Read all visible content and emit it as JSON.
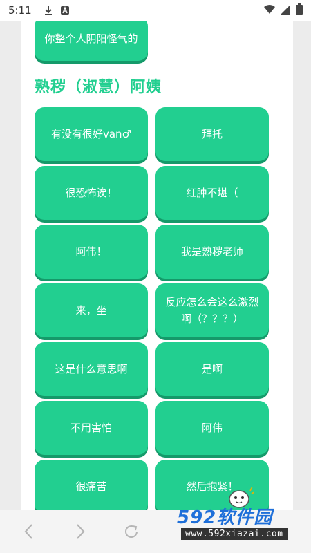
{
  "status_bar": {
    "time": "5:11",
    "icons_left": [
      "download-icon",
      "notification-a-icon"
    ],
    "icons_right": [
      "wifi-icon",
      "signal-icon",
      "battery-icon"
    ]
  },
  "top_partial_button": {
    "label": "你整个人阴阳怪气的"
  },
  "section": {
    "title": "熟秽（淑慧）阿姨"
  },
  "sound_buttons": [
    {
      "label": "有没有很好van♂"
    },
    {
      "label": "拜托"
    },
    {
      "label": "很恐怖诶！"
    },
    {
      "label": "红肿不堪（"
    },
    {
      "label": "阿伟！"
    },
    {
      "label": "我是熟秽老师"
    },
    {
      "label": "来，坐"
    },
    {
      "label": "反应怎么会这么激烈啊（？？？）"
    },
    {
      "label": "这是什么意思啊"
    },
    {
      "label": "是啊"
    },
    {
      "label": "不用害怕"
    },
    {
      "label": "阿伟"
    },
    {
      "label": "很痛苦"
    },
    {
      "label": "然后抱紧！"
    }
  ],
  "nav": {
    "icons": [
      "back-icon",
      "forward-icon",
      "refresh-icon"
    ]
  },
  "watermark": {
    "brand": "592软件园",
    "url": "www.592xiazai.com"
  },
  "colors": {
    "accent": "#22cf90",
    "accent_shadow": "#159a6a",
    "page_bg": "#ececec",
    "watermark_blue": "#1e6fd9"
  }
}
